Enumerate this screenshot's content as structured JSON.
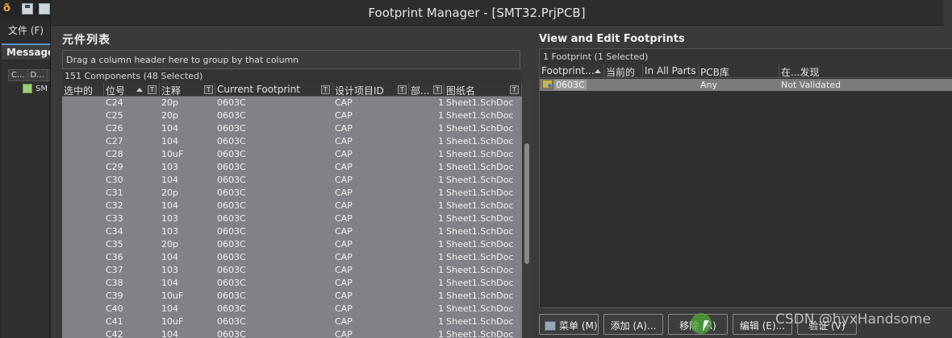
{
  "app": {
    "menu_file": "文件 (F)",
    "messages_tab": "Messages",
    "messages_columns": [
      "C...",
      "D..."
    ],
    "messages_row": "SM"
  },
  "dialog": {
    "title": "Footprint Manager - [SMT32.PrjPCB]"
  },
  "left_panel": {
    "heading": "元件列表",
    "group_hint": "Drag a column header here to group by that column",
    "count": "151 Components (48 Selected)",
    "columns": [
      "选中的",
      "位号",
      "注释",
      "Current Footprint",
      "设计项目ID",
      "部...",
      "图纸名"
    ],
    "rows": [
      {
        "designator": "C24",
        "comment": "20p",
        "footprint": "0603C",
        "design_id": "CAP",
        "part": "1",
        "sheet": "Sheet1.SchDoc"
      },
      {
        "designator": "C25",
        "comment": "20p",
        "footprint": "0603C",
        "design_id": "CAP",
        "part": "1",
        "sheet": "Sheet1.SchDoc"
      },
      {
        "designator": "C26",
        "comment": "104",
        "footprint": "0603C",
        "design_id": "CAP",
        "part": "1",
        "sheet": "Sheet1.SchDoc"
      },
      {
        "designator": "C27",
        "comment": "104",
        "footprint": "0603C",
        "design_id": "CAP",
        "part": "1",
        "sheet": "Sheet1.SchDoc"
      },
      {
        "designator": "C28",
        "comment": "10uF",
        "footprint": "0603C",
        "design_id": "CAP",
        "part": "1",
        "sheet": "Sheet1.SchDoc"
      },
      {
        "designator": "C29",
        "comment": "103",
        "footprint": "0603C",
        "design_id": "CAP",
        "part": "1",
        "sheet": "Sheet1.SchDoc"
      },
      {
        "designator": "C30",
        "comment": "104",
        "footprint": "0603C",
        "design_id": "CAP",
        "part": "1",
        "sheet": "Sheet1.SchDoc"
      },
      {
        "designator": "C31",
        "comment": "20p",
        "footprint": "0603C",
        "design_id": "CAP",
        "part": "1",
        "sheet": "Sheet1.SchDoc"
      },
      {
        "designator": "C32",
        "comment": "104",
        "footprint": "0603C",
        "design_id": "CAP",
        "part": "1",
        "sheet": "Sheet1.SchDoc"
      },
      {
        "designator": "C33",
        "comment": "103",
        "footprint": "0603C",
        "design_id": "CAP",
        "part": "1",
        "sheet": "Sheet1.SchDoc"
      },
      {
        "designator": "C34",
        "comment": "103",
        "footprint": "0603C",
        "design_id": "CAP",
        "part": "1",
        "sheet": "Sheet1.SchDoc"
      },
      {
        "designator": "C35",
        "comment": "20p",
        "footprint": "0603C",
        "design_id": "CAP",
        "part": "1",
        "sheet": "Sheet1.SchDoc"
      },
      {
        "designator": "C36",
        "comment": "104",
        "footprint": "0603C",
        "design_id": "CAP",
        "part": "1",
        "sheet": "Sheet1.SchDoc"
      },
      {
        "designator": "C37",
        "comment": "103",
        "footprint": "0603C",
        "design_id": "CAP",
        "part": "1",
        "sheet": "Sheet1.SchDoc"
      },
      {
        "designator": "C38",
        "comment": "104",
        "footprint": "0603C",
        "design_id": "CAP",
        "part": "1",
        "sheet": "Sheet1.SchDoc"
      },
      {
        "designator": "C39",
        "comment": "10uF",
        "footprint": "0603C",
        "design_id": "CAP",
        "part": "1",
        "sheet": "Sheet1.SchDoc"
      },
      {
        "designator": "C40",
        "comment": "104",
        "footprint": "0603C",
        "design_id": "CAP",
        "part": "1",
        "sheet": "Sheet1.SchDoc"
      },
      {
        "designator": "C41",
        "comment": "10uF",
        "footprint": "0603C",
        "design_id": "CAP",
        "part": "1",
        "sheet": "Sheet1.SchDoc"
      },
      {
        "designator": "C42",
        "comment": "104",
        "footprint": "0603C",
        "design_id": "CAP",
        "part": "1",
        "sheet": "Sheet1.SchDoc"
      }
    ]
  },
  "right_panel": {
    "heading": "View and Edit Footprints",
    "count": "1 Footprint (1 Selected)",
    "columns": [
      "Footprint...",
      "当前的",
      "In All Parts",
      "PCB库",
      "在...发现"
    ],
    "row": {
      "name": "0603C",
      "pcb_lib": "Any",
      "found_in": "Not Validated"
    }
  },
  "buttons": {
    "menu": "菜单 (M)",
    "add": "添加 (A)...",
    "remove": "移除 (R)",
    "edit": "编辑 (E)...",
    "validate": "验证 (V)"
  },
  "watermark": "CSDN @hyxHandsome",
  "colors": {
    "selected_row": "#848087",
    "accent_click": "#50aa3c"
  }
}
